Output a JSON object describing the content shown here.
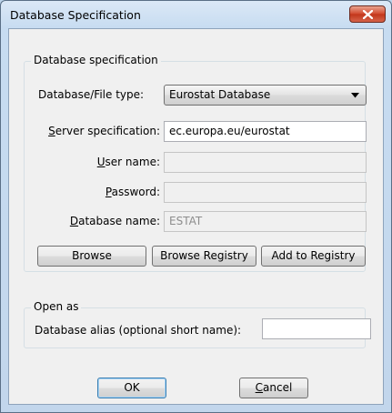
{
  "window": {
    "title": "Database Specification"
  },
  "spec_group": {
    "label": "Database specification",
    "db_type": {
      "label": "Database/File type:",
      "value": "Eurostat Database"
    },
    "server": {
      "label_pre": "",
      "label_key": "S",
      "label_post": "erver specification:",
      "value": "ec.europa.eu/eurostat"
    },
    "username": {
      "label_pre": "",
      "label_key": "U",
      "label_post": "ser name:",
      "value": ""
    },
    "password": {
      "label_pre": "",
      "label_key": "P",
      "label_post": "assword:",
      "value": ""
    },
    "dbname": {
      "label_pre": "",
      "label_key": "D",
      "label_post": "atabase name:",
      "value": "ESTAT"
    },
    "buttons": {
      "browse": "Browse",
      "browse_registry": "Browse Registry",
      "add_registry": "Add to Registry"
    }
  },
  "open_group": {
    "label": "Open as",
    "alias": {
      "label": "Database alias (optional short name):",
      "value": ""
    }
  },
  "footer": {
    "ok": "OK",
    "cancel_key": "C",
    "cancel_post": "ancel"
  },
  "icons": {
    "close": "close-icon",
    "dropdown": "chevron-down-icon"
  },
  "colors": {
    "titlebar": "#c7dcf1",
    "close_button": "#c1351a",
    "dialog_bg": "#f0f0f0"
  }
}
